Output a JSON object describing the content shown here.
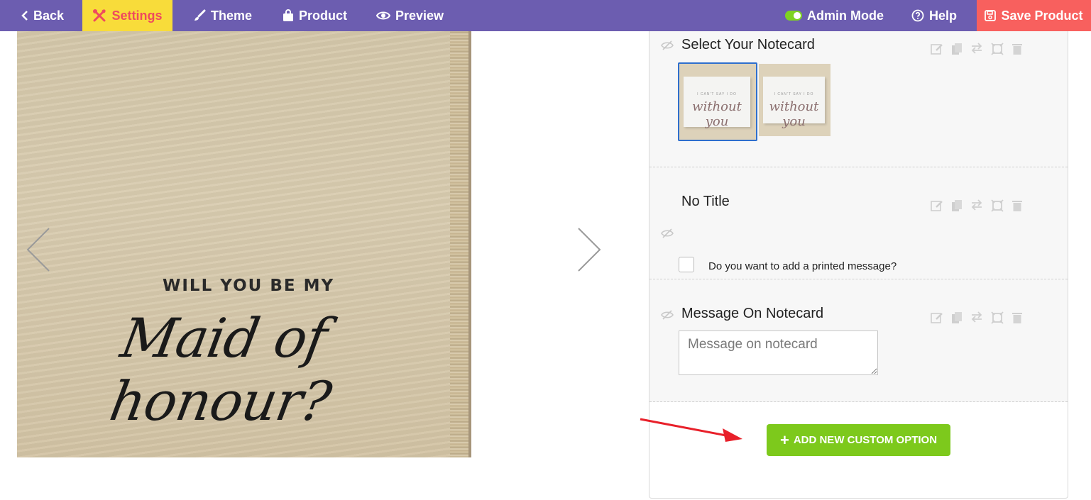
{
  "topbar": {
    "back": "Back",
    "settings": "Settings",
    "theme": "Theme",
    "product": "Product",
    "preview": "Preview",
    "admin_mode": "Admin Mode",
    "help": "Help",
    "save_product": "Save Product"
  },
  "product_image": {
    "line1": "WILL YOU BE MY",
    "line2": "Maid of honour?"
  },
  "options": [
    {
      "title": "Select Your Notecard",
      "thumbnails": [
        {
          "text_top": "I CAN'T SAY I DO",
          "text_script": "without you"
        },
        {
          "text_top": "I CAN'T SAY I DO",
          "text_script": "without you"
        }
      ]
    },
    {
      "title": "No Title",
      "checkbox_label": "Do you want to add a printed message?"
    },
    {
      "title": "Message On Notecard",
      "placeholder": "Message on notecard"
    }
  ],
  "add_button": {
    "label": "ADD NEW CUSTOM OPTION"
  },
  "colors": {
    "topbar": "#6c5db0",
    "settings_bg": "#f8dc3a",
    "settings_fg": "#ef4a5e",
    "save_bg": "#f8605e",
    "toggle": "#7ed321",
    "add_button": "#7dc91c",
    "annotation_arrow": "#e8202a"
  }
}
